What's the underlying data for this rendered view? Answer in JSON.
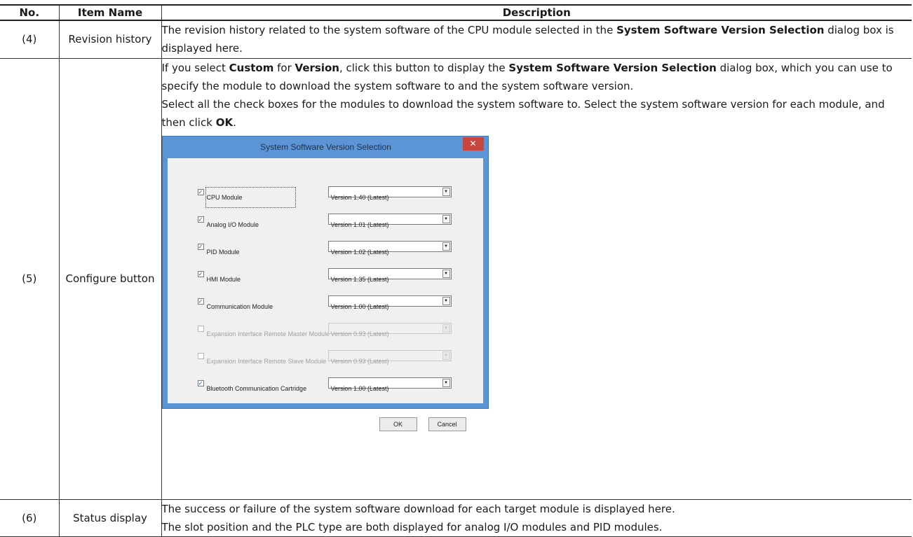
{
  "table": {
    "headers": {
      "no": "No.",
      "item": "Item Name",
      "description": "Description"
    },
    "rows": [
      {
        "no": "(4)",
        "item": "Revision history",
        "desc_1": "The revision history related to the system software of the CPU module selected in the ",
        "desc_2": "System Software Version Selection",
        "desc_3": " dialog box is displayed here."
      },
      {
        "no": "(5)",
        "item": "Configure button",
        "p1_a": "If you select ",
        "p1_b": "Custom",
        "p1_c": " for ",
        "p1_d": "Version",
        "p1_e": ", click this button to display the ",
        "p1_f": "System Software Version Selection",
        "p1_g": " dialog box, which you can use to specify the module to download the system software to and the system software version.",
        "p2_a": "Select all the check boxes for the modules to download the system software to. Select the system software version for each module, and then click ",
        "p2_b": "OK",
        "p2_c": "."
      },
      {
        "no": "(6)",
        "item": "Status display",
        "line1": "The success or failure of the system software download for each target module is displayed here.",
        "line2": "The slot position and the PLC type are both displayed for analog I/O modules and PID modules."
      }
    ]
  },
  "dialog": {
    "title": "System Software Version Selection",
    "close_glyph": "✕",
    "modules": [
      {
        "label": "CPU Module",
        "checked": true,
        "enabled": true,
        "version": "Version 1.40 (Latest)"
      },
      {
        "label": "Analog I/O Module",
        "checked": true,
        "enabled": true,
        "version": "Version 1.01 (Latest)"
      },
      {
        "label": "PID Module",
        "checked": true,
        "enabled": true,
        "version": "Version 1.02 (Latest)"
      },
      {
        "label": "HMI Module",
        "checked": true,
        "enabled": true,
        "version": "Version 1.35 (Latest)"
      },
      {
        "label": "Communication Module",
        "checked": true,
        "enabled": true,
        "version": "Version 1.00 (Latest)"
      },
      {
        "label": "Expansion Interface Remote Master Module",
        "checked": false,
        "enabled": false,
        "version": "Version 0.93 (Latest)"
      },
      {
        "label": "Expansion Interface Remote Slave Module",
        "checked": false,
        "enabled": false,
        "version": "Version 0.93 (Latest)"
      },
      {
        "label": "Bluetooth Communication Cartridge",
        "checked": true,
        "enabled": true,
        "version": "Version 1.00 (Latest)"
      }
    ],
    "ok_label": "OK",
    "cancel_label": "Cancel"
  }
}
